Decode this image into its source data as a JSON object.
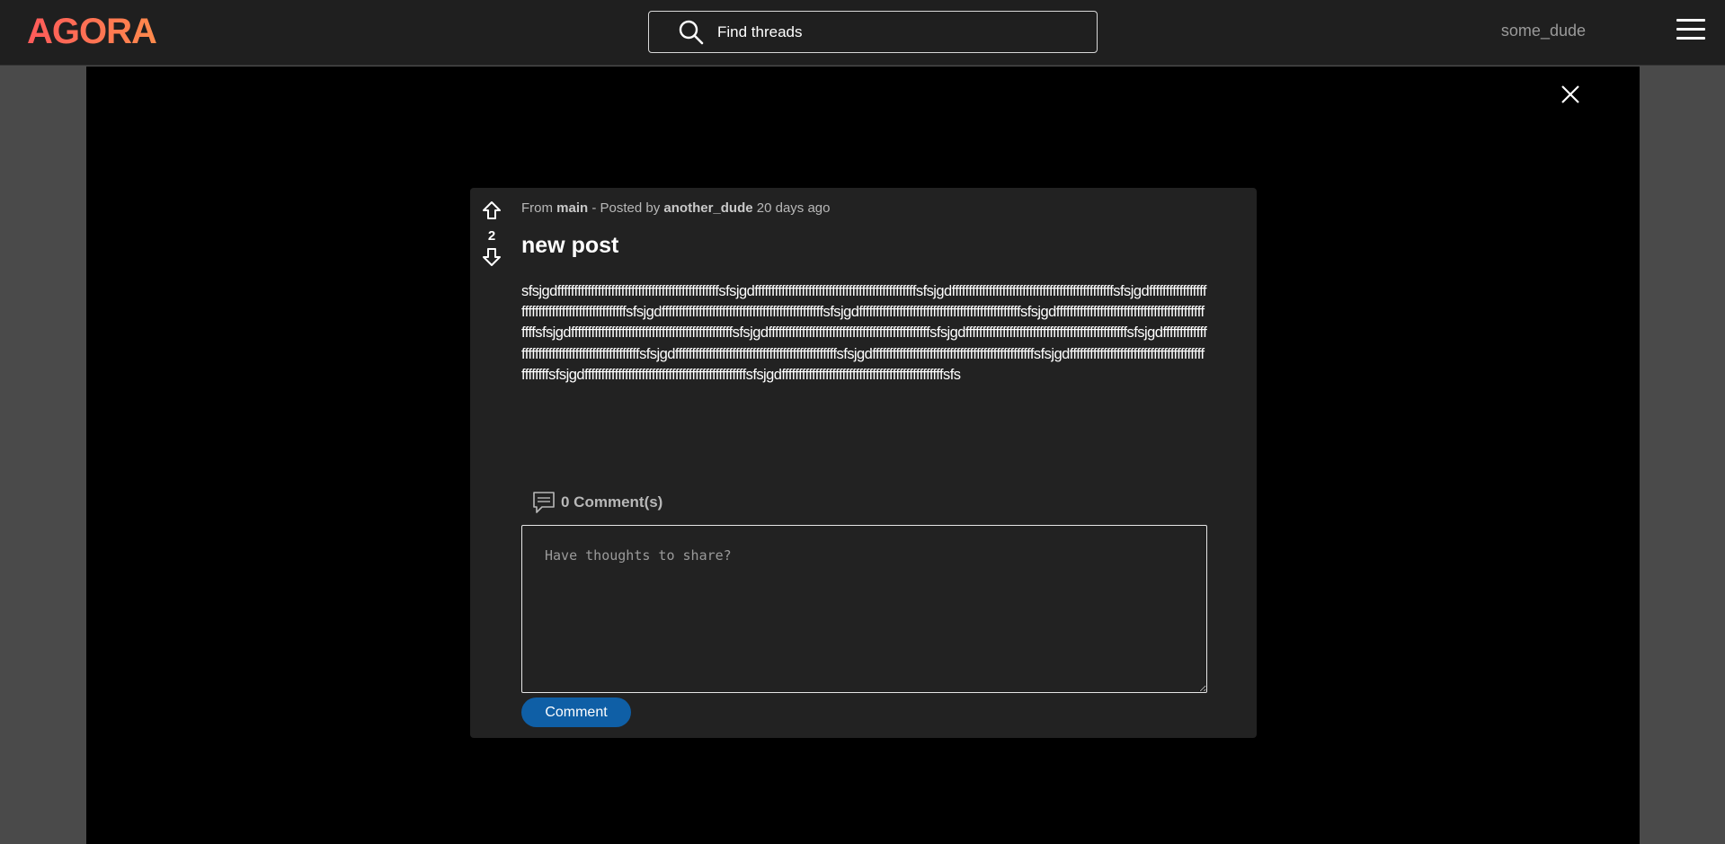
{
  "header": {
    "logo_text": "AGORA",
    "search": {
      "placeholder": "Find threads",
      "value": ""
    },
    "username": "some_dude"
  },
  "post": {
    "community_prefix": "From",
    "community": "main",
    "posted_by_prefix": "- Posted by",
    "author": "another_dude",
    "age": "20 days ago",
    "score": "2",
    "title": "new post",
    "body": "sfsjgdffffffffffffffffffffffffffffffffffffffffffffffffsfsjgdffffffffffffffffffffffffffffffffffffffffffffffffsfsjgdffffffffffffffffffffffffffffffffffffffffffffffffsfsjgdffffffffffffffffffffffffffffffffffffffffffffffffsfsjgdffffffffffffffffffffffffffffffffffffffffffffffffsfsjgdffffffffffffffffffffffffffffffffffffffffffffffffsfsjgdffffffffffffffffffffffffffffffffffffffffffffffffsfsjgdffffffffffffffffffffffffffffffffffffffffffffffffsfsjgdffffffffffffffffffffffffffffffffffffffffffffffffsfsjgdffffffffffffffffffffffffffffffffffffffffffffffffsfsjgdffffffffffffffffffffffffffffffffffffffffffffffffsfsjgdffffffffffffffffffffffffffffffffffffffffffffffffsfsjgdffffffffffffffffffffffffffffffffffffffffffffffffsfsjgdffffffffffffffffffffffffffffffffffffffffffffffffsfsjgdffffffffffffffffffffffffffffffffffffffffffffffffsfsjgdffffffffffffffffffffffffffffffffffffffffffffffffsfs"
  },
  "comments": {
    "count_label": "0 Comment(s)",
    "placeholder": "Have thoughts to share?",
    "submit_label": "Comment"
  },
  "colors": {
    "logo_gradient_start": "#ff5a5a",
    "logo_gradient_end": "#ff8a4c",
    "accent_button": "#0f5fa6",
    "card_bg": "#222222",
    "topbar_bg": "#1f1f1f"
  },
  "icons": {
    "search": "search-icon",
    "menu": "hamburger-menu-icon",
    "close": "close-icon",
    "upvote": "arrow-up-icon",
    "downvote": "arrow-down-icon",
    "comment": "comment-bubble-icon"
  }
}
